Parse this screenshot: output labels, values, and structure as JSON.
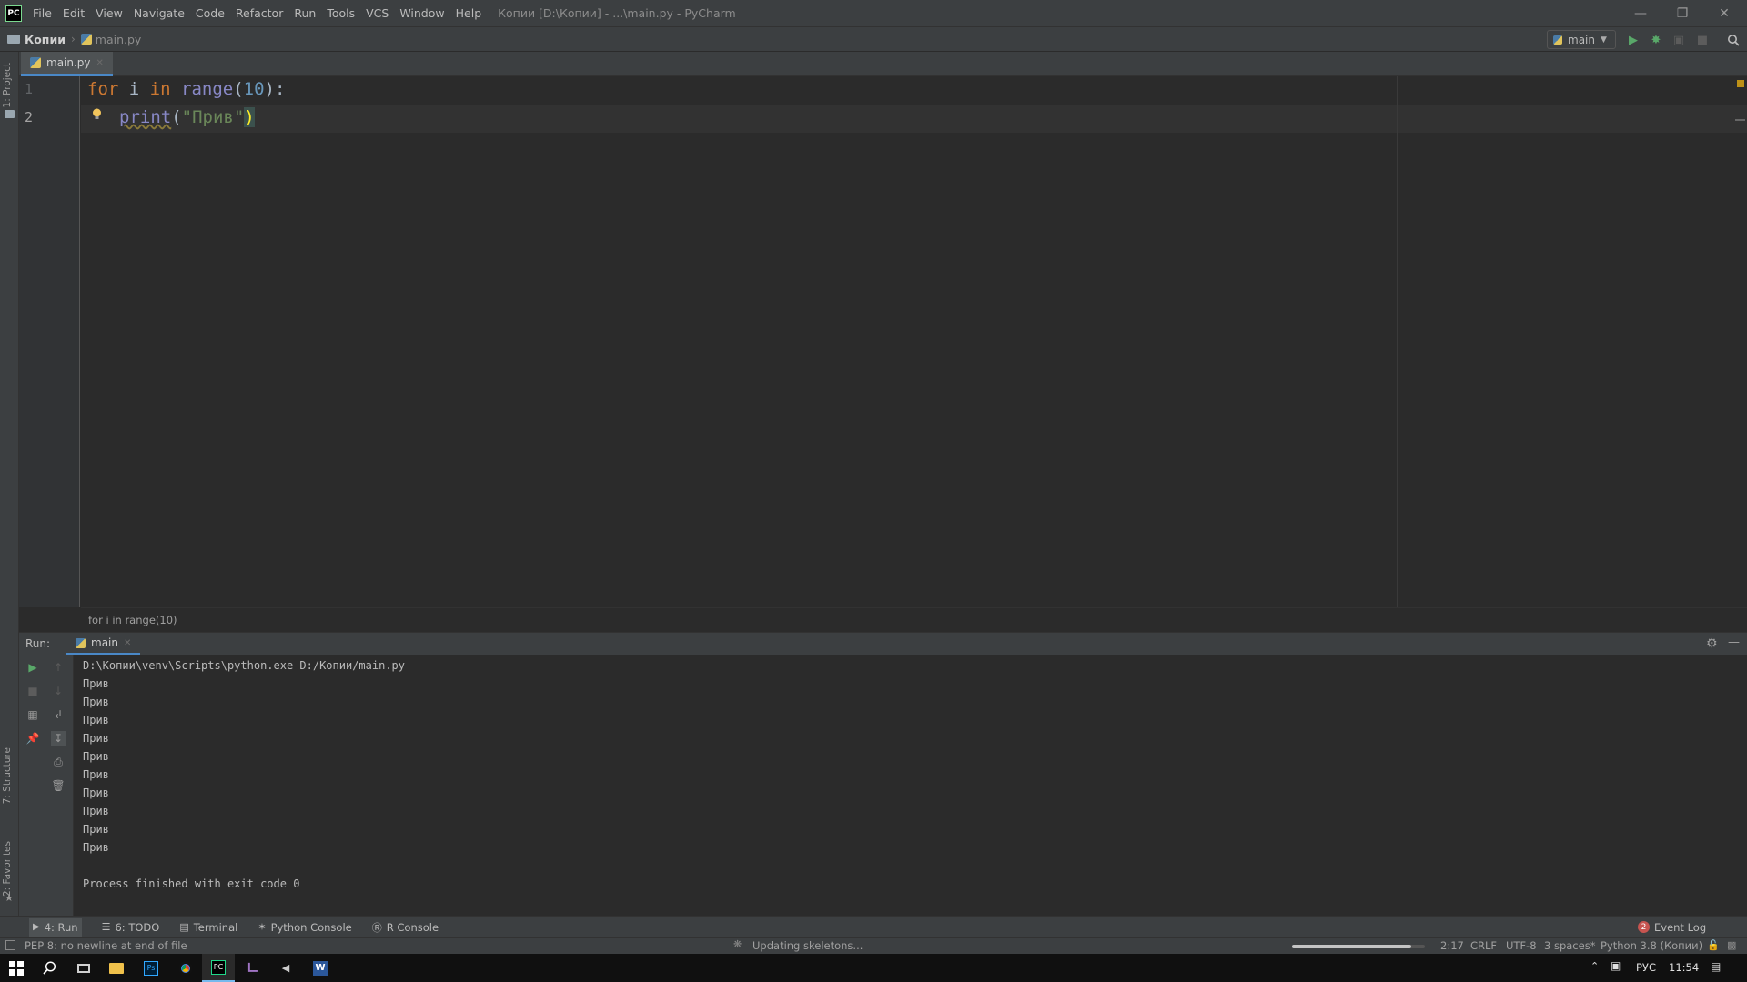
{
  "menu": {
    "logo": "PC",
    "items": [
      "File",
      "Edit",
      "View",
      "Navigate",
      "Code",
      "Refactor",
      "Run",
      "Tools",
      "VCS",
      "Window",
      "Help"
    ],
    "window_title": "Копии [D:\\Копии] - ...\\main.py - PyCharm"
  },
  "navbar": {
    "project": "Копии",
    "file": "main.py",
    "run_config": "main"
  },
  "left_strip": {
    "project": "1: Project",
    "structure": "7: Structure",
    "favorites": "2: Favorites"
  },
  "editor": {
    "tab": "main.py",
    "line_numbers": [
      "1",
      "2"
    ],
    "breadcrumb": "for i in range(10)"
  },
  "run_panel": {
    "label": "Run:",
    "tab": "main",
    "console": [
      "D:\\Копии\\venv\\Scripts\\python.exe D:/Копии/main.py",
      "Прив",
      "Прив",
      "Прив",
      "Прив",
      "Прив",
      "Прив",
      "Прив",
      "Прив",
      "Прив",
      "Прив",
      "",
      "Process finished with exit code 0"
    ]
  },
  "tool_windows": {
    "run": "4: Run",
    "todo": "6: TODO",
    "terminal": "Terminal",
    "python_console": "Python Console",
    "r_console": "R Console",
    "event_log_count": "2",
    "event_log": "Event Log"
  },
  "statusbar": {
    "message": "PEP 8: no newline at end of file",
    "task": "Updating skeletons...",
    "progress": 0.9,
    "position": "2:17",
    "line_sep": "CRLF",
    "encoding": "UTF-8",
    "indent": "3 spaces*",
    "interpreter": "Python 3.8 (Копии)"
  },
  "taskbar": {
    "lang": "РУС",
    "time": "11:54"
  },
  "colors": {
    "keyword": "#cc7832",
    "builtin": "#8888c6",
    "number": "#6897bb",
    "string": "#6a8759",
    "run_green": "#59a869"
  }
}
